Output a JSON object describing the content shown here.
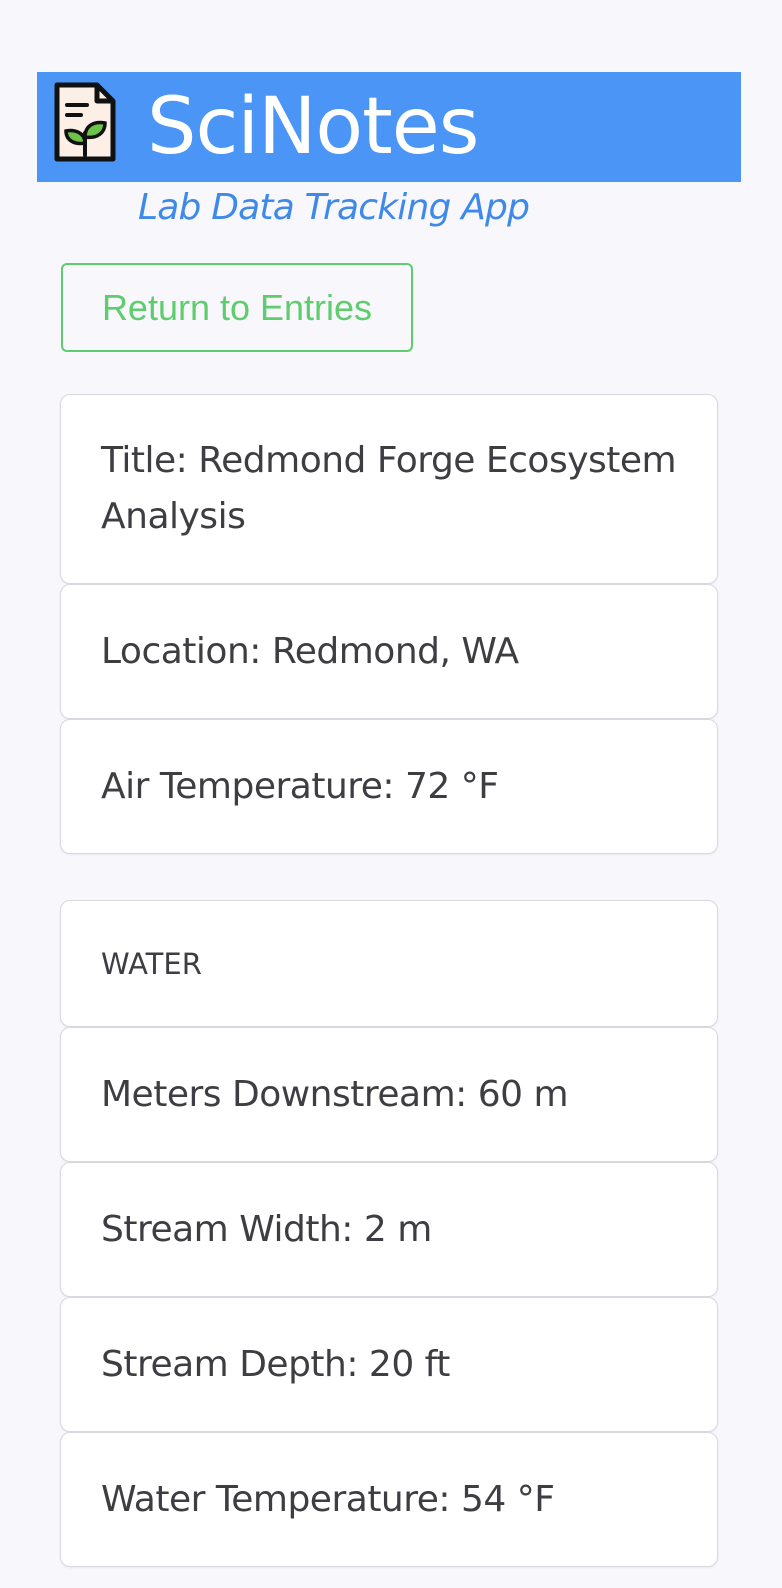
{
  "header": {
    "app_title": "SciNotes",
    "subtitle": "Lab Data Tracking App",
    "logo_icon": "notebook-plant-icon",
    "banner_color": "#4a95f5",
    "subtitle_color": "#3f8ae8"
  },
  "actions": {
    "return_label": "Return to Entries",
    "accent_color": "#5fcd6e"
  },
  "entry": {
    "title": "Title: Redmond Forge Ecosystem Analysis",
    "location": "Location: Redmond, WA",
    "air_temperature": "Air Temperature: 72 °F"
  },
  "water": {
    "section_label": "WATER",
    "meters_downstream": "Meters Downstream: 60 m",
    "stream_width": "Stream Width: 2 m",
    "stream_depth": "Stream Depth: 20 ft",
    "water_temperature": "Water Temperature: 54 °F"
  }
}
